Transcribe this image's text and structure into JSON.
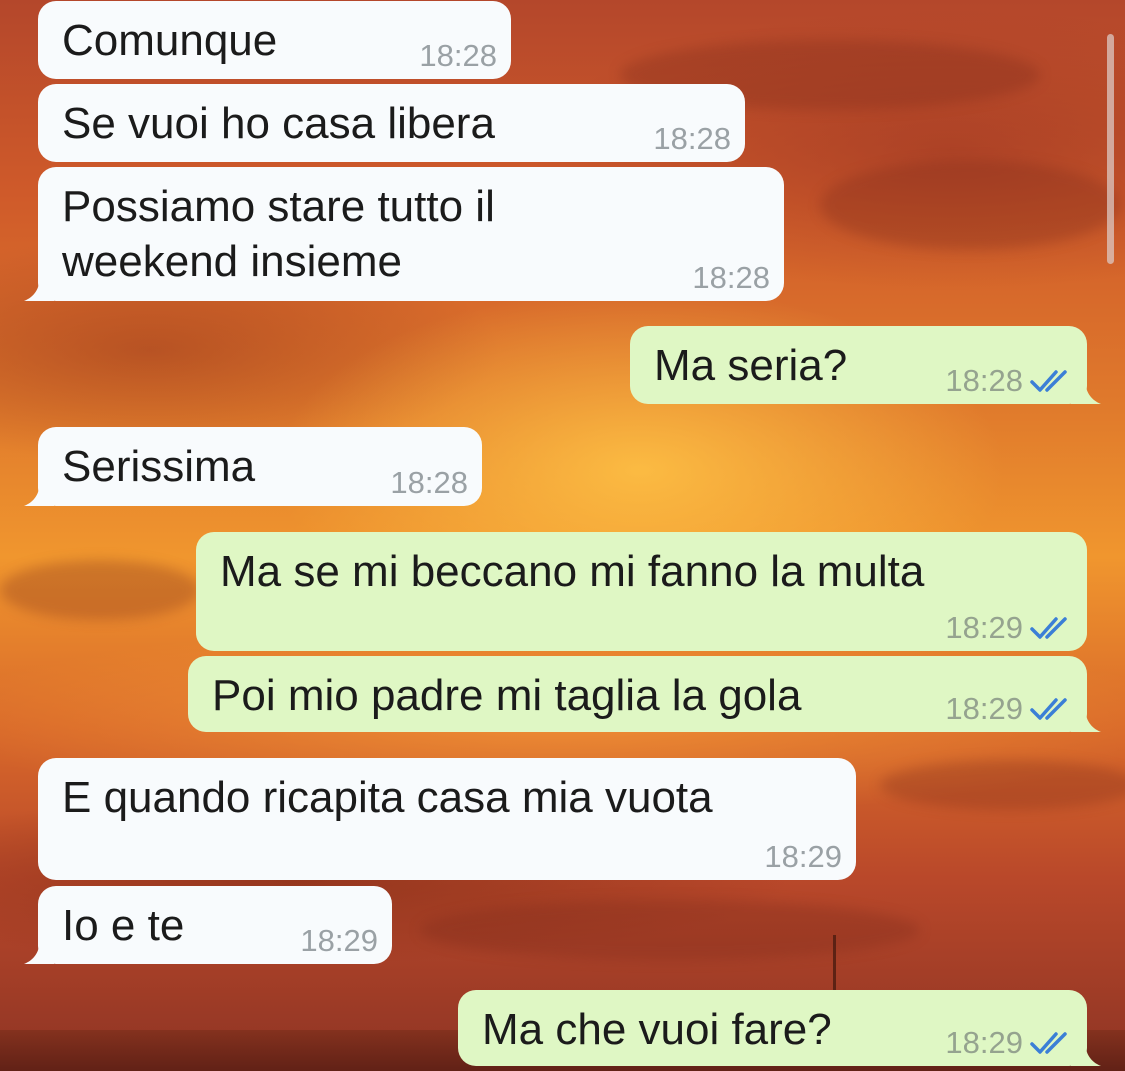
{
  "theme": {
    "incoming_bubble": "#f8fbfd",
    "outgoing_bubble": "#dff7c4",
    "timestamp": "#9aa1a5",
    "read_tick": "#3b7fd6"
  },
  "messages": [
    {
      "direction": "incoming",
      "text": "Comunque",
      "time": "18:28"
    },
    {
      "direction": "incoming",
      "text": "Se vuoi ho casa libera",
      "time": "18:28"
    },
    {
      "direction": "incoming",
      "text": "Possiamo stare tutto il\nweekend insieme",
      "time": "18:28"
    },
    {
      "direction": "outgoing",
      "text": "Ma seria?",
      "time": "18:28",
      "status_icon": "double-check-read-icon"
    },
    {
      "direction": "incoming",
      "text": "Serissima",
      "time": "18:28"
    },
    {
      "direction": "outgoing",
      "text": "Ma se mi beccano mi fanno la multa",
      "time": "18:29",
      "status_icon": "double-check-read-icon"
    },
    {
      "direction": "outgoing",
      "text": "Poi mio padre mi taglia la gola",
      "time": "18:29",
      "status_icon": "double-check-read-icon"
    },
    {
      "direction": "incoming",
      "text": "E quando ricapita casa mia vuota",
      "time": "18:29"
    },
    {
      "direction": "incoming",
      "text": "Io e te",
      "time": "18:29"
    },
    {
      "direction": "outgoing",
      "text": "Ma che vuoi fare?",
      "time": "18:29",
      "status_icon": "double-check-read-icon"
    }
  ]
}
